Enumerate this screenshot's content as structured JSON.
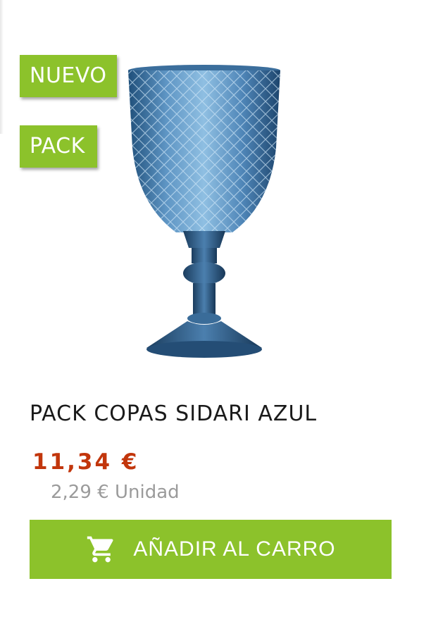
{
  "badges": {
    "new": "NUEVO",
    "pack": "PACK"
  },
  "product": {
    "image_icon": "blue-goblet-image",
    "title": "PACK COPAS SIDARI AZUL",
    "price": "11,34 €",
    "unit_price": "2,29 € Unidad"
  },
  "cart_button": {
    "label": "AÑADIR AL CARRO",
    "icon": "cart-icon"
  },
  "colors": {
    "accent": "#8cc22b",
    "price": "#c2360c",
    "muted": "#9b9b9b"
  }
}
